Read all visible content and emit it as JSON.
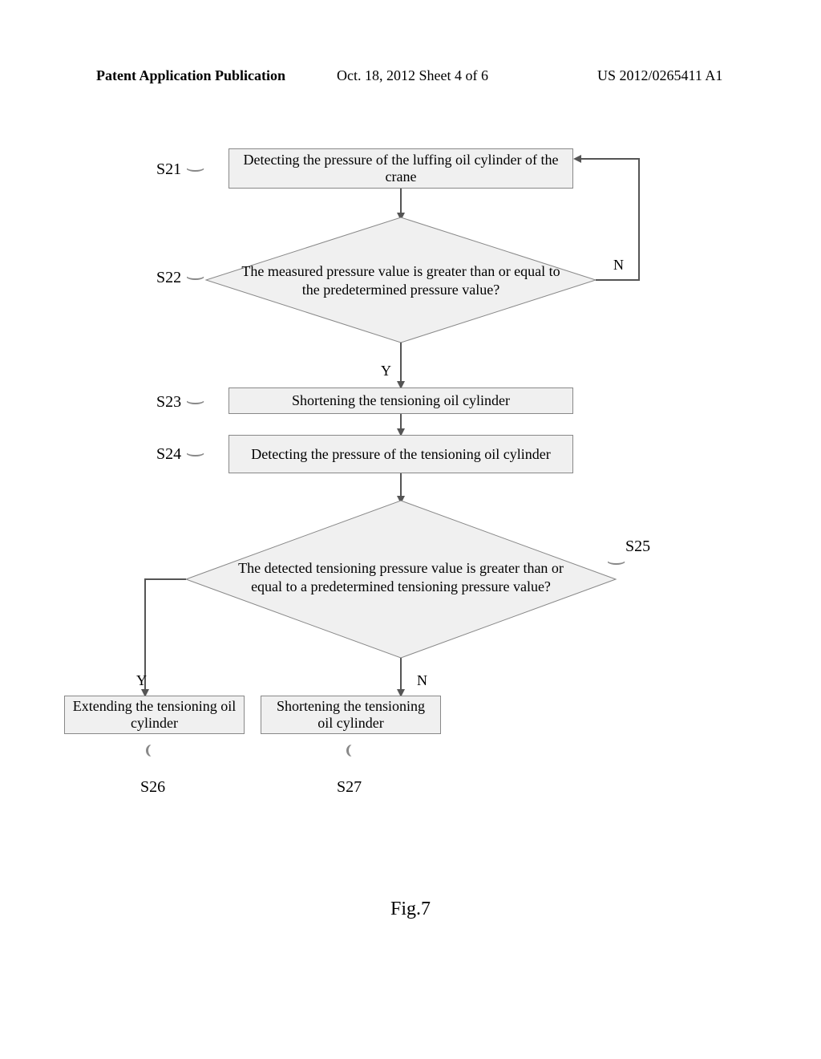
{
  "header": {
    "left": "Patent Application Publication",
    "center": "Oct. 18, 2012  Sheet 4 of 6",
    "right": "US 2012/0265411 A1"
  },
  "labels": {
    "s21": "S21",
    "s22": "S22",
    "s23": "S23",
    "s24": "S24",
    "s25": "S25",
    "s26": "S26",
    "s27": "S27"
  },
  "boxes": {
    "b21": "Detecting the pressure of the luffing oil cylinder of the crane",
    "d22": "The measured pressure value is greater than or equal to the predetermined pressure value?",
    "b23": "Shortening the tensioning oil cylinder",
    "b24": "Detecting the pressure of the tensioning oil cylinder",
    "d25": "The detected tensioning pressure value is greater than or equal to a predetermined tensioning pressure value?",
    "b26": "Extending the tensioning oil cylinder",
    "b27": "Shortening the tensioning oil cylinder"
  },
  "yn": {
    "y": "Y",
    "n": "N"
  },
  "caption": "Fig.7"
}
